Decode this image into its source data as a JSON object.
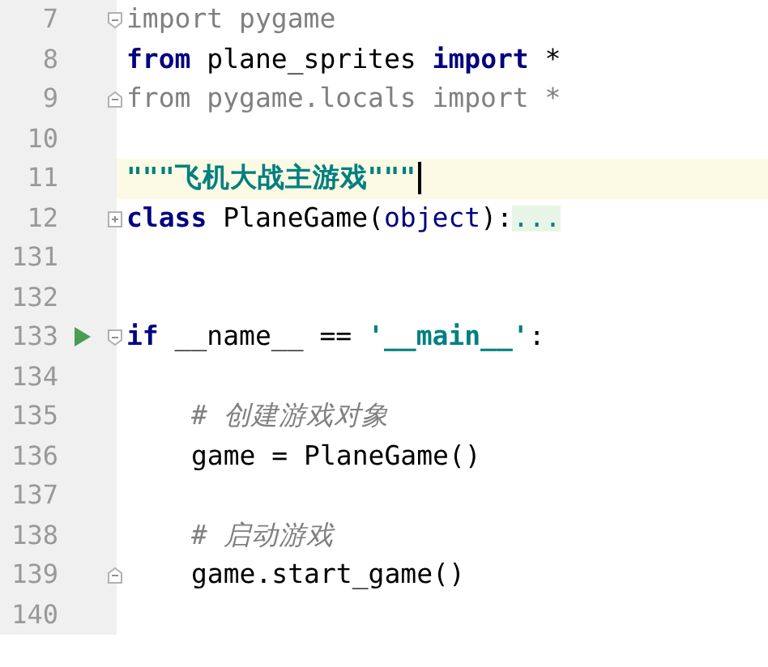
{
  "editor": {
    "lines": [
      {
        "number": "7",
        "fold_start": true,
        "fold_end": false,
        "collapsed": false,
        "run": false,
        "current": false,
        "indent": false,
        "tokens": [
          {
            "kind": "unused",
            "text": "import pygame"
          }
        ]
      },
      {
        "number": "8",
        "fold_start": false,
        "fold_end": false,
        "collapsed": false,
        "run": false,
        "current": false,
        "indent": false,
        "tokens": [
          {
            "kind": "keyword",
            "text": "from"
          },
          {
            "kind": "plain",
            "text": " plane_sprites "
          },
          {
            "kind": "keyword",
            "text": "import"
          },
          {
            "kind": "plain",
            "text": " *"
          }
        ]
      },
      {
        "number": "9",
        "fold_start": false,
        "fold_end": true,
        "collapsed": false,
        "run": false,
        "current": false,
        "indent": false,
        "tokens": [
          {
            "kind": "unused",
            "text": "from pygame.locals import *"
          }
        ]
      },
      {
        "number": "10",
        "fold_start": false,
        "fold_end": false,
        "collapsed": false,
        "run": false,
        "current": false,
        "indent": false
      },
      {
        "number": "11",
        "fold_start": false,
        "fold_end": false,
        "collapsed": false,
        "run": false,
        "current": true,
        "indent": false,
        "tokens": [
          {
            "kind": "docstring",
            "text": "\"\"\"飞机大战主游戏\"\"\""
          }
        ]
      },
      {
        "number": "12",
        "fold_start": false,
        "fold_end": false,
        "collapsed": true,
        "run": false,
        "current": false,
        "indent": false,
        "tokens": [
          {
            "kind": "keyword",
            "text": "class"
          },
          {
            "kind": "plain",
            "text": " PlaneGame("
          },
          {
            "kind": "builtin",
            "text": "object"
          },
          {
            "kind": "plain",
            "text": "):"
          },
          {
            "kind": "folded",
            "text": "..."
          }
        ]
      },
      {
        "number": "131",
        "fold_start": false,
        "fold_end": false,
        "collapsed": false,
        "run": false,
        "current": false,
        "indent": false
      },
      {
        "number": "132",
        "fold_start": false,
        "fold_end": false,
        "collapsed": false,
        "run": false,
        "current": false,
        "indent": false
      },
      {
        "number": "133",
        "fold_start": true,
        "fold_end": false,
        "collapsed": false,
        "run": true,
        "current": false,
        "indent": false,
        "tokens": [
          {
            "kind": "keyword",
            "text": "if"
          },
          {
            "kind": "plain",
            "text": " __name__ == "
          },
          {
            "kind": "string",
            "text": "'__main__'"
          },
          {
            "kind": "plain",
            "text": ":"
          }
        ]
      },
      {
        "number": "134",
        "fold_start": false,
        "fold_end": false,
        "collapsed": false,
        "run": false,
        "current": false,
        "indent": false
      },
      {
        "number": "135",
        "fold_start": false,
        "fold_end": false,
        "collapsed": false,
        "run": false,
        "current": false,
        "indent": true,
        "tokens": [
          {
            "kind": "comment",
            "text": "# 创建游戏对象"
          }
        ]
      },
      {
        "number": "136",
        "fold_start": false,
        "fold_end": false,
        "collapsed": false,
        "run": false,
        "current": false,
        "indent": true,
        "tokens": [
          {
            "kind": "plain",
            "text": "game = PlaneGame()"
          }
        ]
      },
      {
        "number": "137",
        "fold_start": false,
        "fold_end": false,
        "collapsed": false,
        "run": false,
        "current": false,
        "indent": false
      },
      {
        "number": "138",
        "fold_start": false,
        "fold_end": false,
        "collapsed": false,
        "run": false,
        "current": false,
        "indent": true,
        "tokens": [
          {
            "kind": "comment",
            "text": "# 启动游戏"
          }
        ]
      },
      {
        "number": "139",
        "fold_start": false,
        "fold_end": true,
        "collapsed": false,
        "run": false,
        "current": false,
        "indent": true,
        "tokens": [
          {
            "kind": "plain",
            "text": "game.start_game()"
          }
        ]
      },
      {
        "number": "140",
        "fold_start": false,
        "fold_end": false,
        "collapsed": false,
        "run": false,
        "current": false,
        "indent": false
      }
    ]
  }
}
